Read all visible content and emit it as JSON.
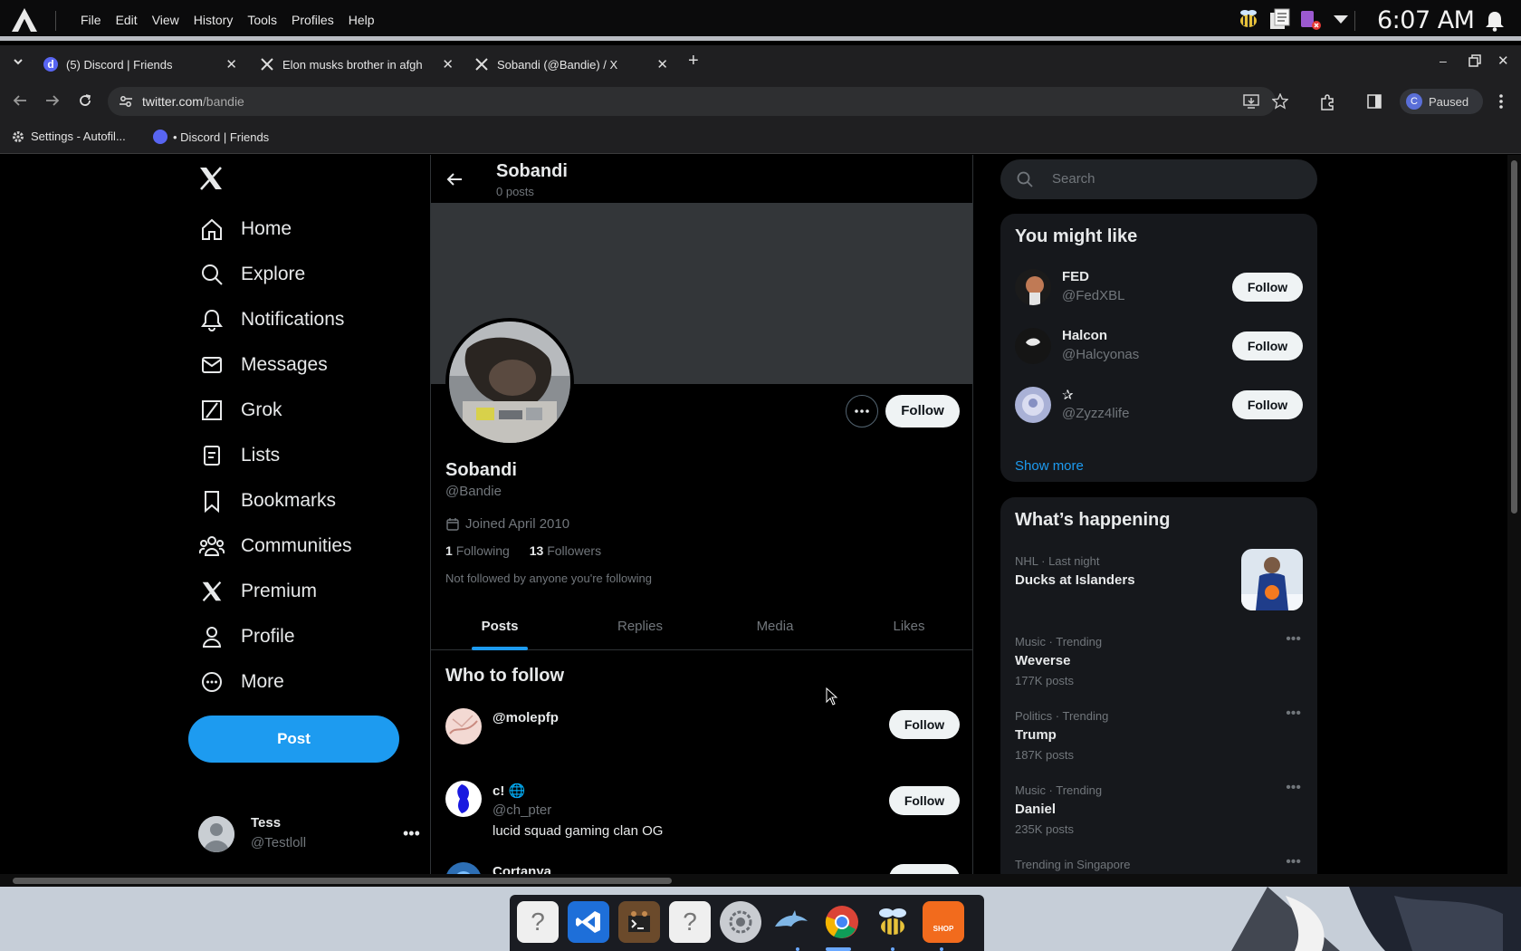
{
  "os": {
    "menu": [
      "File",
      "Edit",
      "View",
      "History",
      "Tools",
      "Profiles",
      "Help"
    ],
    "clock": "6:07 AM"
  },
  "browser": {
    "tabs": [
      {
        "title": "(5) Discord | Friends",
        "icon": "discord-icon"
      },
      {
        "title": "Elon musks brother in afgh",
        "icon": "x-icon"
      },
      {
        "title": "Sobandi (@Bandie) / X",
        "icon": "x-icon"
      }
    ],
    "url_host": "twitter.com",
    "url_path": "/bandie",
    "profile_initial": "C",
    "profile_status": "Paused",
    "bookmarks": [
      "Settings - Autofil...",
      "• Discord | Friends"
    ]
  },
  "nav": {
    "items": [
      "Home",
      "Explore",
      "Notifications",
      "Messages",
      "Grok",
      "Lists",
      "Bookmarks",
      "Communities",
      "Premium",
      "Profile",
      "More"
    ],
    "post_label": "Post",
    "account_name": "Tess",
    "account_handle": "@Testloll"
  },
  "profile": {
    "header_name": "Sobandi",
    "post_count": "0 posts",
    "name": "Sobandi",
    "handle": "@Bandie",
    "joined": "Joined April 2010",
    "following_count": "1",
    "following_label": "Following",
    "followers_count": "13",
    "followers_label": "Followers",
    "note": "Not followed by anyone you're following",
    "follow_label": "Follow",
    "tabs": [
      "Posts",
      "Replies",
      "Media",
      "Likes"
    ]
  },
  "who_to_follow": {
    "title": "Who to follow",
    "accounts": [
      {
        "name": "@molepfp",
        "handle": "",
        "bio": "",
        "button": "Follow"
      },
      {
        "name": "c! 🌐",
        "handle": "@ch_pter",
        "bio": "lucid squad gaming clan OG",
        "button": "Follow"
      },
      {
        "name": "Cortanya",
        "handle": "",
        "bio": "",
        "button": "Follow"
      }
    ]
  },
  "search": {
    "placeholder": "Search"
  },
  "might_like": {
    "title": "You might like",
    "accounts": [
      {
        "name": "FED",
        "handle": "@FedXBL",
        "button": "Follow"
      },
      {
        "name": "Halcon",
        "handle": "@Halcyonas",
        "button": "Follow"
      },
      {
        "name": "✰",
        "handle": "@Zyzz4life",
        "button": "Follow"
      }
    ],
    "show_more": "Show more"
  },
  "happening": {
    "title": "What’s happening",
    "trends": [
      {
        "context": "NHL · Last night",
        "title": "Ducks at Islanders",
        "count": ""
      },
      {
        "context": "Music · Trending",
        "title": "Weverse",
        "count": "177K posts"
      },
      {
        "context": "Politics · Trending",
        "title": "Trump",
        "count": "187K posts"
      },
      {
        "context": "Music · Trending",
        "title": "Daniel",
        "count": "235K posts"
      },
      {
        "context": "Trending in Singapore",
        "title": "",
        "count": ""
      }
    ]
  },
  "dock": {
    "apps": [
      "unknown-file-icon",
      "vscode-icon",
      "terminal-icon",
      "unknown-file-icon",
      "settings-icon",
      "dolphin-icon",
      "chrome-icon",
      "bee-icon",
      "shop-icon"
    ],
    "shop_label": "SHOP"
  },
  "colors": {
    "accent": "#1d9bf0",
    "background": "#000000",
    "card": "#16181c",
    "muted": "#71767b"
  }
}
